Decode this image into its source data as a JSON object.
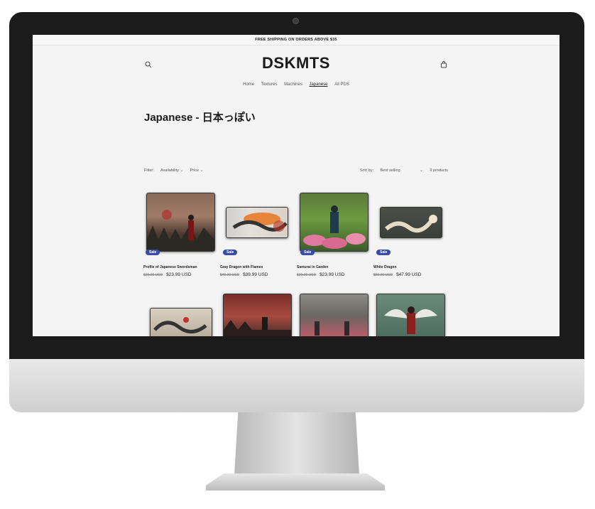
{
  "announcement": "FREE SHIPPING ON ORDERS ABOVE $35",
  "logo": "DSKMTS",
  "nav": [
    "Home",
    "Textures",
    "Machines",
    "Japanese",
    "All PDS"
  ],
  "page_title": "Japanese - 日本っぽい",
  "filters": {
    "label": "Filter:",
    "availability": "Availability ⌄",
    "price": "Price ⌄",
    "sort_label": "Sort by:",
    "sort_value": "Best selling",
    "sort_arrow": "⌄",
    "count": "9 products"
  },
  "products": [
    {
      "name": "Profile of Japanese Swordsman",
      "old_price": "$29.99 USD",
      "price": "$23.99 USD",
      "badge": "Sale"
    },
    {
      "name": "Gray Dragon with Flames",
      "old_price": "$49.99 USD",
      "price": "$39.99 USD",
      "badge": "Sale"
    },
    {
      "name": "Samurai in Garden",
      "old_price": "$29.99 USD",
      "price": "$23.99 USD",
      "badge": "Sale"
    },
    {
      "name": "White Dragon",
      "old_price": "$59.99 USD",
      "price": "$47.99 USD",
      "badge": "Sale"
    }
  ],
  "icons": {
    "search": "search-icon",
    "cart": "cart-icon"
  },
  "colors": {
    "sale_badge": "#3a4ca8",
    "screen_bg": "#f4f4f4"
  }
}
